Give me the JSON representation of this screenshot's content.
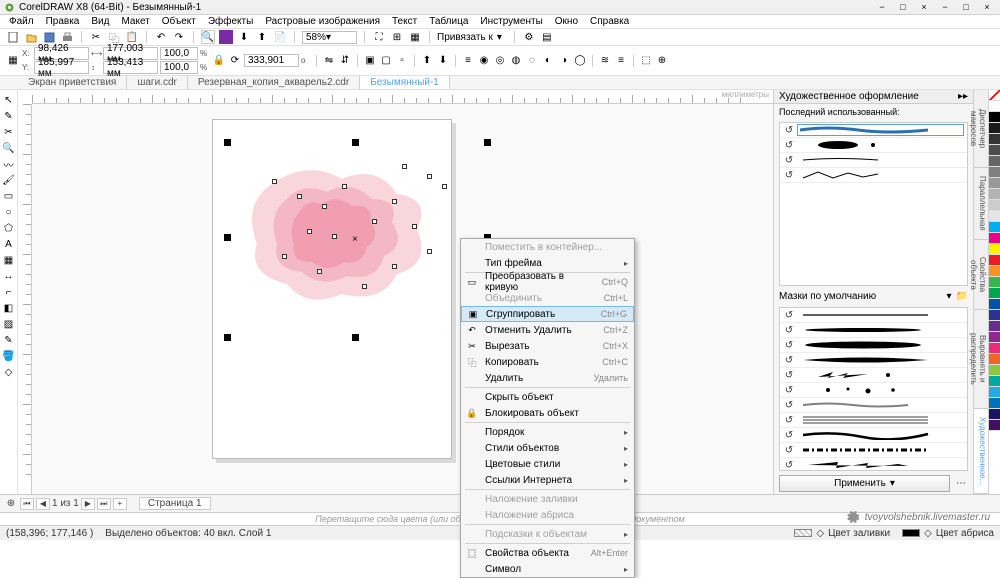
{
  "app": {
    "title": "CorelDRAW X8 (64-Bit) - Безымянный-1"
  },
  "menu": [
    "Файл",
    "Правка",
    "Вид",
    "Макет",
    "Объект",
    "Эффекты",
    "Растровые изображения",
    "Текст",
    "Таблица",
    "Инструменты",
    "Окно",
    "Справка"
  ],
  "toolbar": {
    "zoom": "58%",
    "snap": "Привязать к"
  },
  "prop": {
    "x": "98,426 мм",
    "y": "185,997 мм",
    "w": "177,003 мм",
    "h": "153,413 мм",
    "sx": "100,0",
    "sy": "100,0",
    "pct": "%",
    "rot": "333,901",
    "deg": "o"
  },
  "tabs": [
    {
      "label": "Экран приветствия",
      "active": false
    },
    {
      "label": "шаги.cdr",
      "active": false
    },
    {
      "label": "Резервная_копия_акварель2.cdr",
      "active": false
    },
    {
      "label": "Безымянный-1",
      "active": true
    }
  ],
  "ruler_unit": "миллиметры",
  "ctx": [
    {
      "icon": "",
      "text": "Поместить в контейнер...",
      "disabled": true
    },
    {
      "icon": "",
      "text": "Тип фрейма",
      "sub": true
    },
    {
      "sep": true
    },
    {
      "icon": "▭",
      "text": "Преобразовать в кривую",
      "cut": "Ctrl+Q"
    },
    {
      "icon": "",
      "text": "Объединить",
      "cut": "Ctrl+L",
      "disabled": true
    },
    {
      "icon": "▣",
      "text": "Сгруппировать",
      "cut": "Ctrl+G",
      "hl": true
    },
    {
      "icon": "↶",
      "text": "Отменить Удалить",
      "cut": "Ctrl+Z"
    },
    {
      "icon": "✂",
      "text": "Вырезать",
      "cut": "Ctrl+X"
    },
    {
      "icon": "⿻",
      "text": "Копировать",
      "cut": "Ctrl+C"
    },
    {
      "icon": "",
      "text": "Удалить",
      "cut": "Удалить"
    },
    {
      "sep": true
    },
    {
      "icon": "",
      "text": "Скрыть объект"
    },
    {
      "icon": "🔒",
      "text": "Блокировать объект"
    },
    {
      "sep": true
    },
    {
      "icon": "",
      "text": "Порядок",
      "sub": true
    },
    {
      "icon": "",
      "text": "Стили объектов",
      "sub": true
    },
    {
      "icon": "",
      "text": "Цветовые стили",
      "sub": true
    },
    {
      "icon": "",
      "text": "Ссылки Интернета",
      "sub": true
    },
    {
      "sep": true
    },
    {
      "icon": "",
      "text": "Наложение заливки",
      "disabled": true
    },
    {
      "icon": "",
      "text": "Наложение абриса",
      "disabled": true
    },
    {
      "sep": true
    },
    {
      "icon": "",
      "text": "Подсказки к объектам",
      "sub": true,
      "disabled": true
    },
    {
      "sep": true
    },
    {
      "icon": "⿴",
      "text": "Свойства объекта",
      "cut": "Alt+Enter"
    },
    {
      "icon": "",
      "text": "Символ",
      "sub": true
    }
  ],
  "docker": {
    "title": "Художественное оформление",
    "last": "Последний использованный:",
    "brushset": "Мазки по умолчанию",
    "apply": "Применить",
    "vtabs": [
      "Диспетчер макросов",
      "Параллельная",
      "Свойства объекта",
      "Выровнять и распределить",
      "Художественное..."
    ]
  },
  "page": {
    "of": "из",
    "nums": "1 из 1",
    "tab": "Страница 1"
  },
  "hint": "Перетащите сюда цвета (или объекты), чтобы сохранить их вместе с документом",
  "status": {
    "coords": "(158,396; 177,146 )",
    "sel": "Выделено объектов: 40 вкл. Слой 1",
    "fill": "Цвет заливки",
    "outline": "Цвет абриса"
  },
  "colors": [
    "#ffffff",
    "#000000",
    "#1a1a1a",
    "#333333",
    "#4d4d4d",
    "#666666",
    "#808080",
    "#999999",
    "#b3b3b3",
    "#cccccc",
    "#e5e5e5",
    "#00aeef",
    "#ec008c",
    "#fff200",
    "#ed1c24",
    "#f7941d",
    "#39b54a",
    "#00a651",
    "#0054a6",
    "#2e3192",
    "#662d91",
    "#92278f",
    "#ee2a7b",
    "#f26522",
    "#8dc63f",
    "#00a99d",
    "#25aae1",
    "#0072bc",
    "#1b1464",
    "#440e62"
  ],
  "watermark": "tvoyvolshebnik.livemaster.ru"
}
